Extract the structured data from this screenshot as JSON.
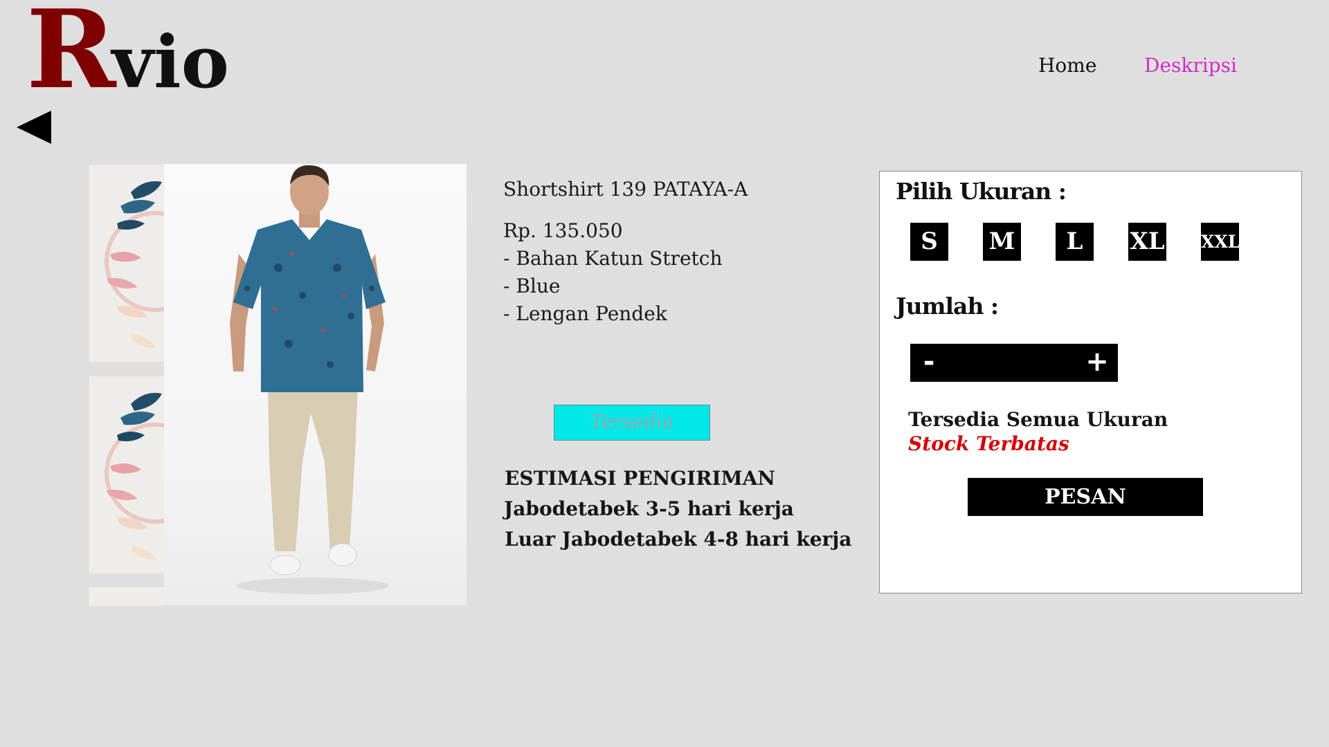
{
  "brand": {
    "logo_initial": "R",
    "logo_rest": "vio"
  },
  "nav": {
    "items": [
      {
        "label": "Home"
      },
      {
        "label": "Deskripsi"
      }
    ]
  },
  "product": {
    "name": "Shortshirt 139 PATAYA-A",
    "price": "Rp. 135.050",
    "features": [
      "- Bahan Katun Stretch",
      "- Blue",
      "- Lengan Pendek"
    ],
    "availability": "Tersedia"
  },
  "shipping": {
    "title": "ESTIMASI PENGIRIMAN",
    "lines": [
      "Jabodetabek 3-5 hari kerja",
      "Luar Jabodetabek 4-8 hari kerja"
    ]
  },
  "order_panel": {
    "size_label": "Pilih Ukuran :",
    "sizes": [
      "S",
      "M",
      "L",
      "XL",
      "XXL"
    ],
    "quantity_label": "Jumlah :",
    "minus": "-",
    "plus": "+",
    "notes": [
      "Tersedia Semua Ukuran",
      "Stock Terbatas"
    ],
    "order_button": "PESAN"
  },
  "colors": {
    "background": "#e0dfe0",
    "logo_initial": "#7f0000",
    "nav_active": "#d22ac7",
    "availability_badge": "#00e8e8",
    "stock_warning": "#d50000"
  },
  "icons": {
    "back": "back-triangle-icon"
  }
}
